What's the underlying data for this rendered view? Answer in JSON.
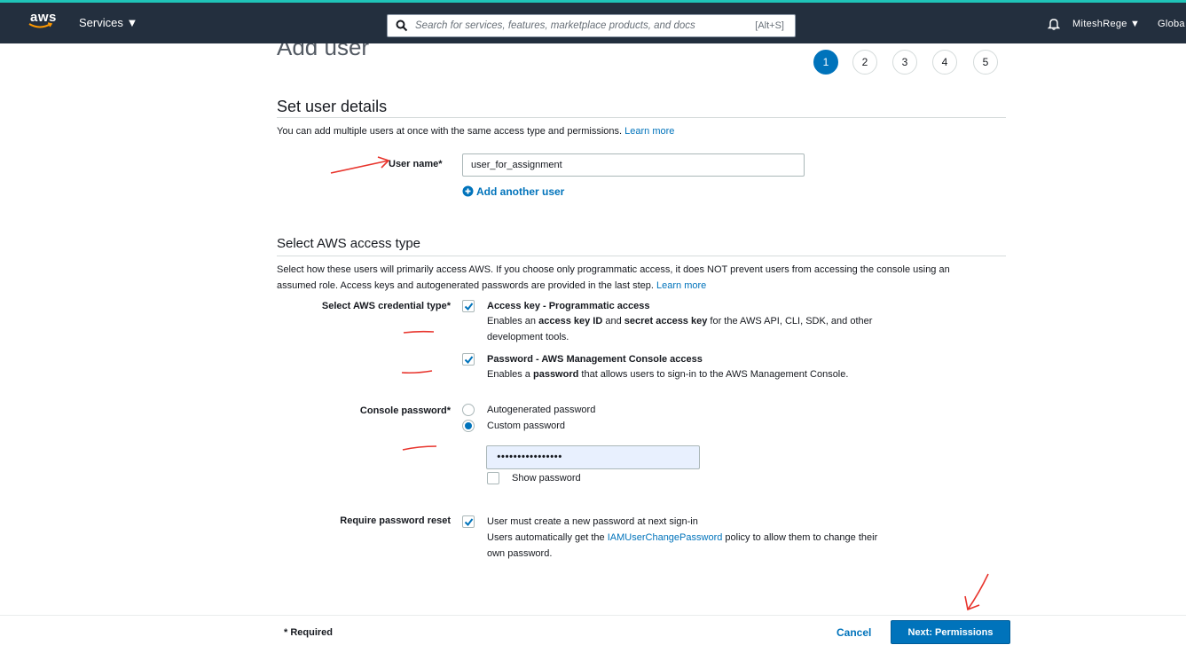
{
  "nav": {
    "logo": "aws",
    "services_label": "Services ▼",
    "search_placeholder": "Search for services, features, marketplace products, and docs",
    "search_shortcut": "[Alt+S]",
    "account": "MiteshRege ▼",
    "region": "Globa",
    "accent_color": "#1fc4b8",
    "bar_color": "#232f3e"
  },
  "header": {
    "title": "Add user",
    "steps": [
      "1",
      "2",
      "3",
      "4",
      "5"
    ],
    "active_step": "1"
  },
  "details": {
    "heading": "Set user details",
    "description": "You can add multiple users at once with the same access type and permissions.",
    "learn_more": "Learn more",
    "username_label": "User name*",
    "username_value": "user_for_assignment",
    "add_another": "Add another user"
  },
  "access": {
    "heading": "Select AWS access type",
    "description_1": "Select how these users will primarily access AWS. If you choose only programmatic access, it does NOT prevent users from accessing the console using an",
    "description_2": "assumed role. Access keys and autogenerated passwords are provided in the last step.",
    "learn_more": "Learn more",
    "credential_label": "Select AWS credential type*",
    "access_key": {
      "title": "Access key - Programmatic access",
      "text_a": "Enables an ",
      "bold_a": "access key ID",
      "text_b": " and ",
      "bold_b": "secret access key",
      "text_c": " for the AWS API, CLI, SDK, and other",
      "text_d": "development tools.",
      "checked": true
    },
    "console_access": {
      "title": "Password - AWS Management Console access",
      "text_a": "Enables a ",
      "bold_a": "password",
      "text_b": " that allows users to sign-in to the AWS Management Console.",
      "checked": true
    },
    "console_password_label": "Console password*",
    "autogenerated": "Autogenerated password",
    "custom": "Custom password",
    "selected_password_type": "Custom password",
    "password_value": "••••••••••••••••",
    "show_password": "Show password",
    "reset_label": "Require password reset",
    "reset_title": "User must create a new password at next sign-in",
    "reset_text_a": "Users automatically get the ",
    "reset_policy": "IAMUserChangePassword",
    "reset_text_b": " policy to allow them to change their",
    "reset_text_c": "own password."
  },
  "footer": {
    "required": "* Required",
    "cancel": "Cancel",
    "next": "Next: Permissions"
  },
  "colors": {
    "link": "#0073bb",
    "annotation": "#e8342c"
  }
}
